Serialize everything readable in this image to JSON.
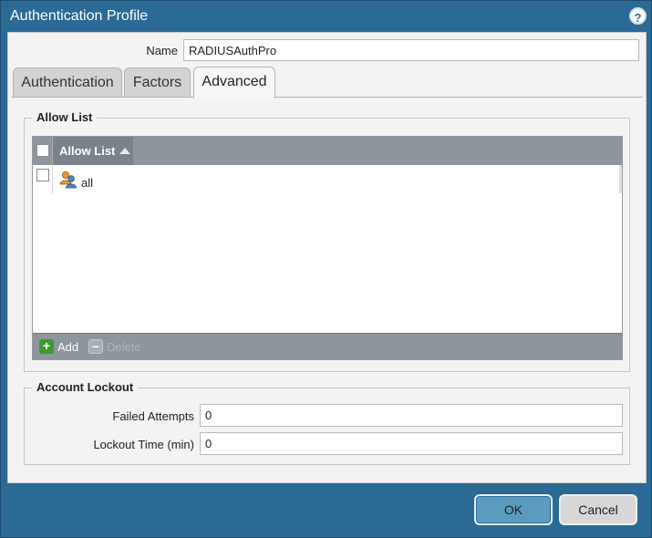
{
  "dialog": {
    "title": "Authentication Profile",
    "help_icon": "help-icon",
    "help_glyph": "?"
  },
  "name_field": {
    "label": "Name",
    "value": "RADIUSAuthPro"
  },
  "tabs": [
    {
      "label": "Authentication",
      "active": false
    },
    {
      "label": "Factors",
      "active": false
    },
    {
      "label": "Advanced",
      "active": true
    }
  ],
  "allow_list": {
    "legend": "Allow List",
    "column_header": "Allow List",
    "sort_icon": "sort-ascending-icon",
    "rows": [
      {
        "icon": "user-group-icon",
        "text": "all"
      }
    ],
    "toolbar": {
      "add_label": "Add",
      "delete_label": "Delete",
      "add_glyph": "+",
      "delete_glyph": "−"
    }
  },
  "account_lockout": {
    "legend": "Account Lockout",
    "failed_attempts_label": "Failed Attempts",
    "failed_attempts_value": "0",
    "lockout_time_label": "Lockout Time (min)",
    "lockout_time_value": "0"
  },
  "buttons": {
    "ok_label": "OK",
    "cancel_label": "Cancel"
  },
  "colors": {
    "frame": "#2b6a94",
    "grid_header": "#8d969c",
    "ok_button": "#5b9bbf",
    "add_icon": "#3f9a2e",
    "delete_icon": "#a9aeb1"
  }
}
